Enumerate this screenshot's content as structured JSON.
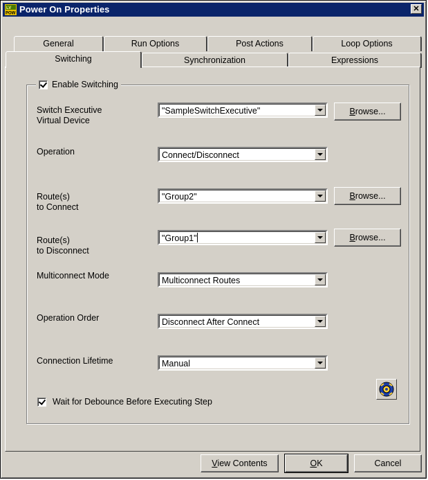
{
  "window": {
    "title": "Power On Properties",
    "close_glyph": "✕",
    "app_icon": "labview-power-icon"
  },
  "tabs": {
    "row1": [
      "General",
      "Run Options",
      "Post Actions",
      "Loop Options"
    ],
    "row2": [
      "Switching",
      "Synchronization",
      "Expressions"
    ],
    "active": "Switching"
  },
  "switching": {
    "enable_label": "Enable Switching",
    "enable_checked": true,
    "switch_exec_label_line1": "Switch Executive",
    "switch_exec_label_line2": "Virtual Device",
    "switch_exec_value": "\"SampleSwitchExecutive\"",
    "operation_label": "Operation",
    "operation_value": "Connect/Disconnect",
    "routes_connect_line1": "Route(s)",
    "routes_connect_line2": "to Connect",
    "routes_connect_value": "\"Group2\"",
    "routes_disconnect_line1": "Route(s)",
    "routes_disconnect_line2": "to Disconnect",
    "routes_disconnect_value": "\"Group1\"",
    "multiconnect_label": "Multiconnect Mode",
    "multiconnect_value": "Multiconnect Routes",
    "operation_order_label": "Operation Order",
    "operation_order_value": "Disconnect After Connect",
    "connection_lifetime_label": "Connection Lifetime",
    "connection_lifetime_value": "Manual",
    "debounce_label": "Wait for Debounce Before Executing Step",
    "debounce_checked": true,
    "browse_label_first": "B",
    "browse_label_rest": "rowse...",
    "gear_icon": "switch-gear-icon"
  },
  "footer": {
    "view_contents_first": "V",
    "view_contents_rest": "iew Contents",
    "ok_first": "O",
    "ok_rest": "K",
    "cancel": "Cancel"
  }
}
